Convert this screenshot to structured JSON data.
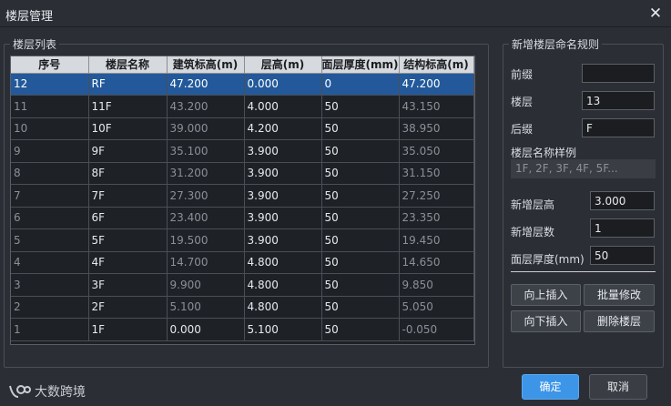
{
  "window": {
    "title": "楼层管理",
    "close_icon": "close-icon"
  },
  "floor_list": {
    "group_label": "楼层列表",
    "columns": [
      "序号",
      "楼层名称",
      "建筑标高(m)",
      "层高(m)",
      "面层厚度(mm)",
      "结构标高(m)"
    ],
    "rows": [
      [
        "12",
        "RF",
        "47.200",
        "0.000",
        "0",
        "47.200"
      ],
      [
        "11",
        "11F",
        "43.200",
        "4.000",
        "50",
        "43.150"
      ],
      [
        "10",
        "10F",
        "39.000",
        "4.200",
        "50",
        "38.950"
      ],
      [
        "9",
        "9F",
        "35.100",
        "3.900",
        "50",
        "35.050"
      ],
      [
        "8",
        "8F",
        "31.200",
        "3.900",
        "50",
        "31.150"
      ],
      [
        "7",
        "7F",
        "27.300",
        "3.900",
        "50",
        "27.250"
      ],
      [
        "6",
        "6F",
        "23.400",
        "3.900",
        "50",
        "23.350"
      ],
      [
        "5",
        "5F",
        "19.500",
        "3.900",
        "50",
        "19.450"
      ],
      [
        "4",
        "4F",
        "14.700",
        "4.800",
        "50",
        "14.650"
      ],
      [
        "3",
        "3F",
        "9.900",
        "4.800",
        "50",
        "9.850"
      ],
      [
        "2",
        "2F",
        "5.100",
        "4.800",
        "50",
        "5.050"
      ],
      [
        "1",
        "1F",
        "0.000",
        "5.100",
        "50",
        "-0.050"
      ]
    ],
    "selected_row": 0
  },
  "naming_rules": {
    "group_label": "新增楼层命名规则",
    "prefix_label": "前缀",
    "prefix_value": "",
    "floor_label": "楼层",
    "floor_value": "13",
    "suffix_label": "后缀",
    "suffix_value": "F",
    "sample_label": "楼层名称样例",
    "sample_value": "1F, 2F, 3F, 4F, 5F...",
    "height_label": "新增层高",
    "height_value": "3.000",
    "count_label": "新增层数",
    "count_value": "1",
    "thickness_label": "面层厚度(mm)",
    "thickness_value": "50"
  },
  "actions": {
    "insert_above": "向上插入",
    "batch_edit": "批量修改",
    "insert_below": "向下插入",
    "delete_floor": "删除楼层",
    "ok": "确定",
    "cancel": "取消"
  },
  "watermark": {
    "text": "大数跨境"
  }
}
